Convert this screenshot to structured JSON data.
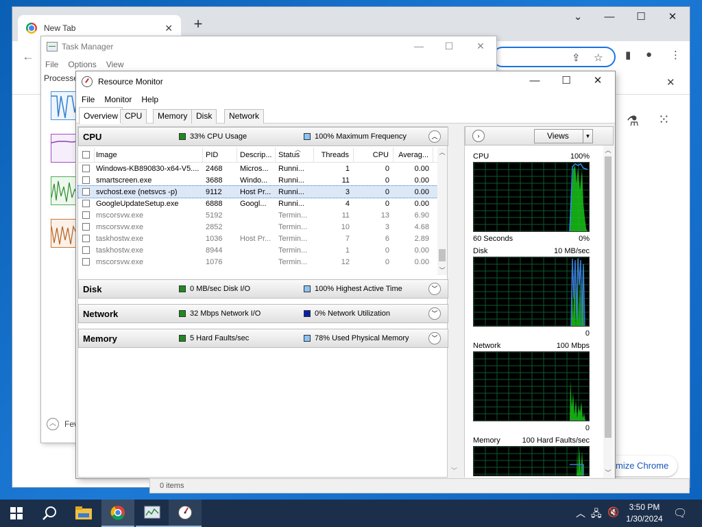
{
  "chrome": {
    "tab_title": "New Tab",
    "new_tab_symbol": "+",
    "customize_label": "mize Chrome"
  },
  "task_manager": {
    "title": "Task Manager",
    "menu": [
      "File",
      "Options",
      "View"
    ],
    "processes_tab": "Processe",
    "fewer_details": "Few"
  },
  "resource_monitor": {
    "title": "Resource Monitor",
    "menu": [
      "File",
      "Monitor",
      "Help"
    ],
    "tabs": [
      "Overview",
      "CPU",
      "Memory",
      "Disk",
      "Network"
    ],
    "active_tab": "Overview",
    "sections": {
      "cpu": {
        "name": "CPU",
        "stat1": "33% CPU Usage",
        "stat2": "100% Maximum Frequency"
      },
      "disk": {
        "name": "Disk",
        "stat1": "0 MB/sec Disk I/O",
        "stat2": "100% Highest Active Time"
      },
      "network": {
        "name": "Network",
        "stat1": "32 Mbps Network I/O",
        "stat2": "0% Network Utilization"
      },
      "memory": {
        "name": "Memory",
        "stat1": "5 Hard Faults/sec",
        "stat2": "78% Used Physical Memory"
      }
    },
    "columns": [
      "Image",
      "PID",
      "Descrip...",
      "Status",
      "Threads",
      "CPU",
      "Averag..."
    ],
    "rows": [
      {
        "image": "Windows-KB890830-x64-V5....",
        "pid": "2468",
        "desc": "Micros...",
        "status": "Runni...",
        "threads": "1",
        "cpu": "0",
        "avg": "0.00",
        "state": "running"
      },
      {
        "image": "smartscreen.exe",
        "pid": "3688",
        "desc": "Windo...",
        "status": "Runni...",
        "threads": "11",
        "cpu": "0",
        "avg": "0.00",
        "state": "running"
      },
      {
        "image": "svchost.exe (netsvcs -p)",
        "pid": "9112",
        "desc": "Host Pr...",
        "status": "Runni...",
        "threads": "3",
        "cpu": "0",
        "avg": "0.00",
        "state": "selected"
      },
      {
        "image": "GoogleUpdateSetup.exe",
        "pid": "6888",
        "desc": "Googl...",
        "status": "Runni...",
        "threads": "4",
        "cpu": "0",
        "avg": "0.00",
        "state": "running"
      },
      {
        "image": "mscorsvw.exe",
        "pid": "5192",
        "desc": "",
        "status": "Termin...",
        "threads": "11",
        "cpu": "13",
        "avg": "6.90",
        "state": "terminated"
      },
      {
        "image": "mscorsvw.exe",
        "pid": "2852",
        "desc": "",
        "status": "Termin...",
        "threads": "10",
        "cpu": "3",
        "avg": "4.68",
        "state": "terminated"
      },
      {
        "image": "taskhostw.exe",
        "pid": "1036",
        "desc": "Host Pr...",
        "status": "Termin...",
        "threads": "7",
        "cpu": "6",
        "avg": "2.89",
        "state": "terminated"
      },
      {
        "image": "taskhostw.exe",
        "pid": "8944",
        "desc": "",
        "status": "Termin...",
        "threads": "1",
        "cpu": "0",
        "avg": "0.00",
        "state": "terminated"
      },
      {
        "image": "mscorsvw.exe",
        "pid": "1076",
        "desc": "",
        "status": "Termin...",
        "threads": "12",
        "cpu": "0",
        "avg": "0.00",
        "state": "terminated"
      }
    ],
    "views_label": "Views",
    "graphs": {
      "cpu": {
        "label": "CPU",
        "max": "100%",
        "time_label": "60 Seconds",
        "min": "0%"
      },
      "disk": {
        "label": "Disk",
        "max": "10 MB/sec",
        "min": "0"
      },
      "network": {
        "label": "Network",
        "max": "100 Mbps",
        "min": "0"
      },
      "memory": {
        "label": "Memory",
        "max": "100 Hard Faults/sec"
      }
    }
  },
  "behind_strip_text": "0 items",
  "taskbar": {
    "time": "3:50 PM",
    "date": "1/30/2024"
  },
  "colors": {
    "graph_green": "#19c219",
    "graph_blue": "#3a7bd5",
    "stat_green": "#1e8a1e",
    "stat_light_blue": "#8cc3f5",
    "stat_dark_blue": "#0a1fa8"
  }
}
